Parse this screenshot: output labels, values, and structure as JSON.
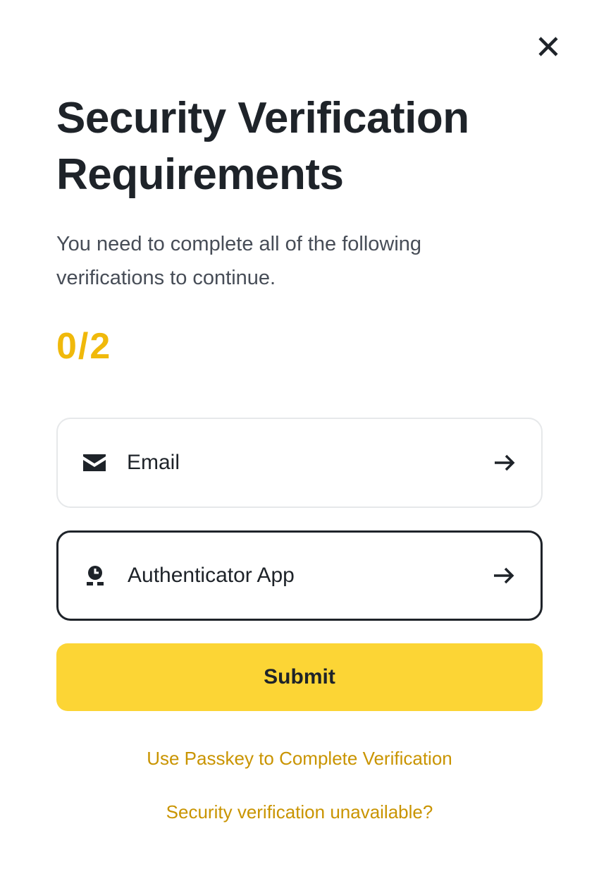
{
  "dialog": {
    "title": "Security Verification Requirements",
    "subtitle": "You need to complete all of the following verifications to continue.",
    "progress": "0/2",
    "close_icon": "close-icon"
  },
  "options": [
    {
      "label": "Email",
      "icon": "envelope-icon",
      "action_icon": "arrow-right-icon"
    },
    {
      "label": "Authenticator App",
      "icon": "authenticator-icon",
      "action_icon": "arrow-right-icon"
    }
  ],
  "submit_label": "Submit",
  "links": {
    "passkey": "Use Passkey to Complete Verification",
    "unavailable": "Security verification unavailable?"
  },
  "colors": {
    "accent": "#FCD535",
    "progress": "#F0B90B",
    "link": "#C99400",
    "text": "#1E2329",
    "muted": "#474D57"
  }
}
